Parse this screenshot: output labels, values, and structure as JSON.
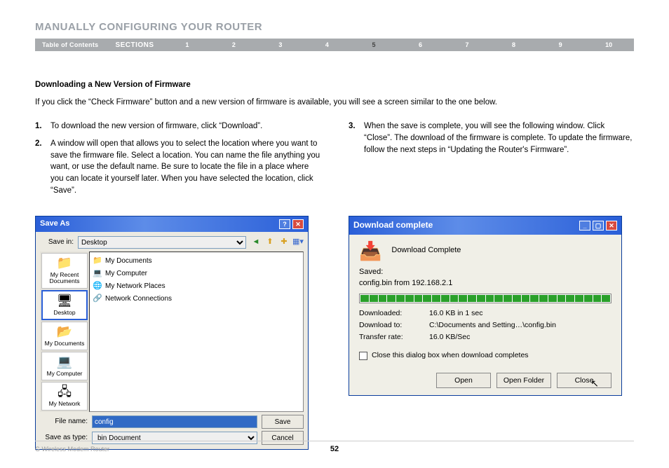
{
  "heading": "MANUALLY CONFIGURING YOUR ROUTER",
  "nav": {
    "toc": "Table of Contents",
    "sections_label": "SECTIONS",
    "numbers": [
      "1",
      "2",
      "3",
      "4",
      "5",
      "6",
      "7",
      "8",
      "9",
      "10"
    ],
    "active": "5"
  },
  "section_title": "Downloading a New Version of Firmware",
  "intro": "If you click the “Check Firmware” button and a new version of firmware is available, you will see a screen similar to the one below.",
  "steps": {
    "1": "To download the new version of firmware, click “Download”.",
    "2": "A window will open that allows you to select the location where you want to save the firmware file. Select a location. You can name the file anything you want, or use the default name. Be sure to locate the file in a place where you can locate it yourself later. When you have selected the location, click “Save”.",
    "3": "When the save is complete, you will see the following window. Click “Close”. The download of the firmware is complete. To update the firmware, follow the next steps in “Updating the Router's Firmware”."
  },
  "save_dialog": {
    "title": "Save As",
    "savein_label": "Save in:",
    "savein_value": "Desktop",
    "sidebar": [
      {
        "icon": "📁",
        "label": "My Recent Documents"
      },
      {
        "icon": "🖥",
        "label": "Desktop"
      },
      {
        "icon": "📂",
        "label": "My Documents"
      },
      {
        "icon": "💻",
        "label": "My Computer"
      },
      {
        "icon": "🖧",
        "label": "My Network"
      }
    ],
    "files": [
      {
        "icon": "📁",
        "name": "My Documents"
      },
      {
        "icon": "💻",
        "name": "My Computer"
      },
      {
        "icon": "🌐",
        "name": "My Network Places"
      },
      {
        "icon": "🔗",
        "name": "Network Connections"
      }
    ],
    "filename_label": "File name:",
    "filename_value": "config",
    "type_label": "Save as type:",
    "type_value": "bin Document",
    "save_btn": "Save",
    "cancel_btn": "Cancel"
  },
  "download_dialog": {
    "title": "Download complete",
    "heading": "Download Complete",
    "saved_label": "Saved:",
    "saved_value": "config.bin from 192.168.2.1",
    "stats": {
      "downloaded_label": "Downloaded:",
      "downloaded_value": "16.0 KB in 1 sec",
      "to_label": "Download to:",
      "to_value": "C:\\Documents and Setting…\\config.bin",
      "rate_label": "Transfer rate:",
      "rate_value": "16.0 KB/Sec"
    },
    "checkbox_label": "Close this dialog box when download completes",
    "open_btn": "Open",
    "folder_btn": "Open Folder",
    "close_btn": "Close"
  },
  "footer": {
    "product": "G Wireless Modem Router",
    "page": "52"
  }
}
